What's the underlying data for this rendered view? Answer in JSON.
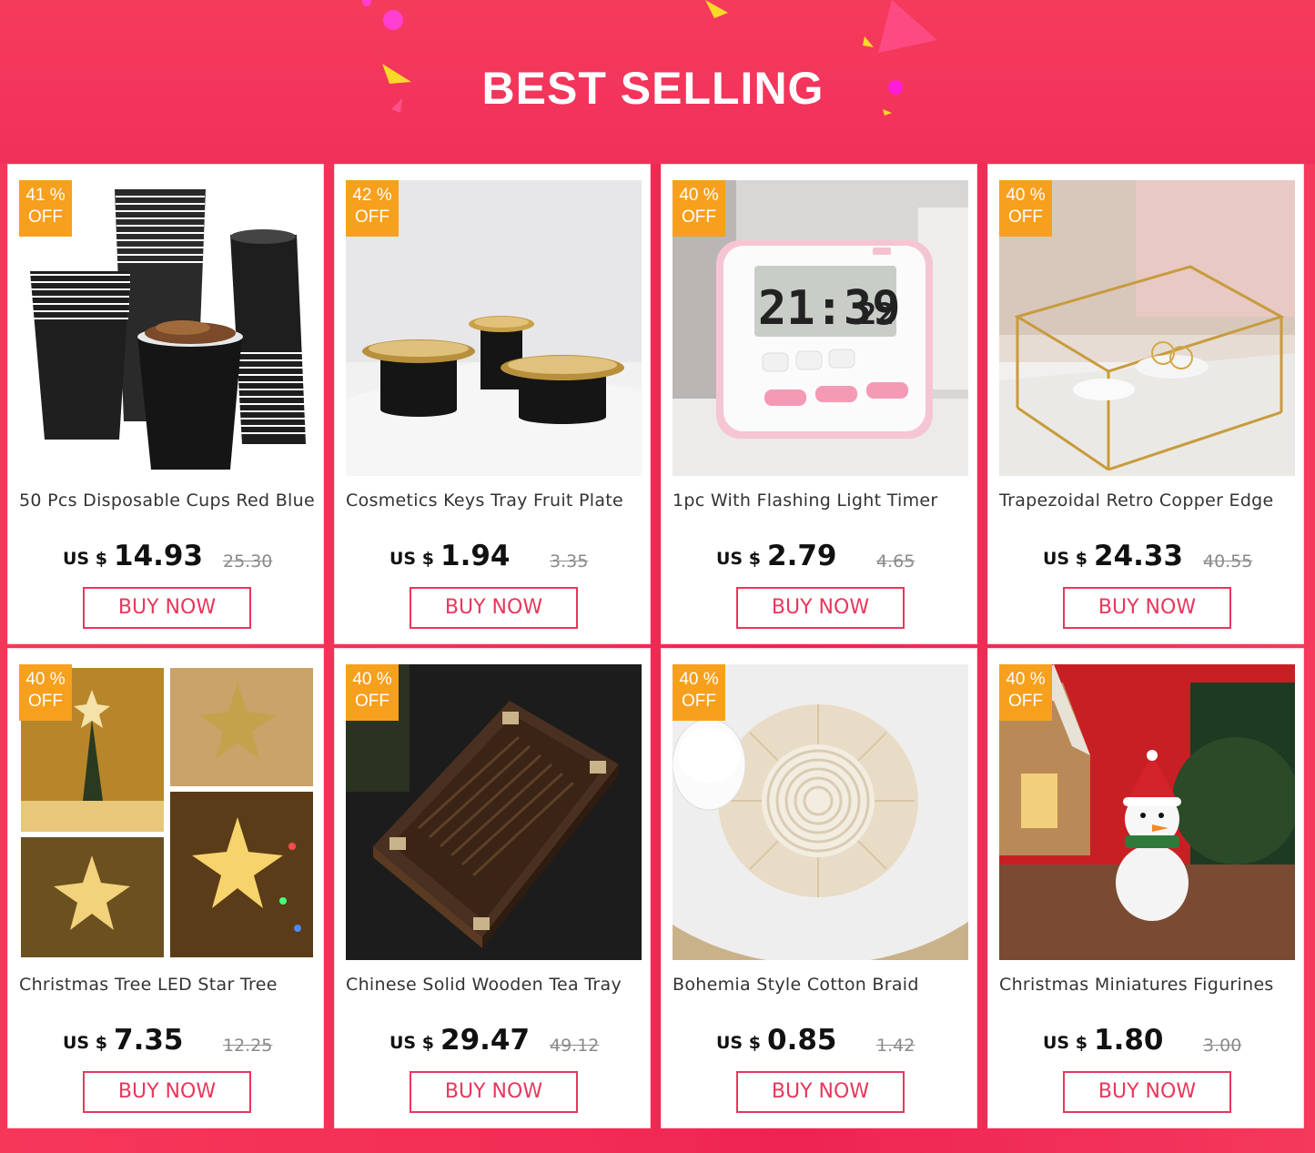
{
  "header": {
    "title": "BEST SELLING"
  },
  "colors": {
    "background": "#f32e56",
    "badge": "#f7a01d",
    "button": "#e8375c"
  },
  "products": [
    {
      "discount": "41 %",
      "off": "OFF",
      "title": "50 Pcs Disposable Cups Red Blue",
      "currency": "US $",
      "price": "14.93",
      "old_price": "25.30",
      "button": "BUY NOW",
      "image": "black-party-cups-image"
    },
    {
      "discount": "42 %",
      "off": "OFF",
      "title": "Cosmetics Keys  Tray Fruit Plate",
      "currency": "US $",
      "price": "1.94",
      "old_price": "3.35",
      "button": "BUY NOW",
      "image": "gold-tray-stands-image"
    },
    {
      "discount": "40 %",
      "off": "OFF",
      "title": "1pc With Flashing Light Timer",
      "currency": "US $",
      "price": "2.79",
      "old_price": "4.65",
      "button": "BUY NOW",
      "image": "pink-digital-timer-image",
      "timer_display": "21:39",
      "timer_seconds": "22"
    },
    {
      "discount": "40 %",
      "off": "OFF",
      "title": "Trapezoidal Retro Copper Edge",
      "currency": "US $",
      "price": "24.33",
      "old_price": "40.55",
      "button": "BUY NOW",
      "image": "glass-jewelry-box-image"
    },
    {
      "discount": "40 %",
      "off": "OFF",
      "title": "Christmas Tree LED Star Tree",
      "currency": "US $",
      "price": "7.35",
      "old_price": "12.25",
      "button": "BUY NOW",
      "image": "star-tree-topper-image"
    },
    {
      "discount": "40 %",
      "off": "OFF",
      "title": "Chinese Solid Wooden Tea Tray",
      "currency": "US $",
      "price": "29.47",
      "old_price": "49.12",
      "button": "BUY NOW",
      "image": "wooden-tea-tray-image"
    },
    {
      "discount": "40 %",
      "off": "OFF",
      "title": "Bohemia Style Cotton Braid",
      "currency": "US $",
      "price": "0.85",
      "old_price": "1.42",
      "button": "BUY NOW",
      "image": "cotton-braid-coaster-image"
    },
    {
      "discount": "40 %",
      "off": "OFF",
      "title": "Christmas Miniatures Figurines",
      "currency": "US $",
      "price": "1.80",
      "old_price": "3.00",
      "button": "BUY NOW",
      "image": "snowman-figurine-image"
    }
  ]
}
